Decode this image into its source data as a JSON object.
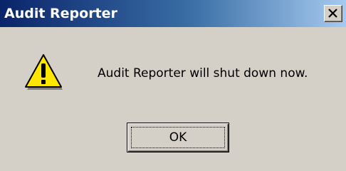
{
  "window": {
    "title": "Audit Reporter",
    "close_icon": "close-icon",
    "background_color": "#d4d0c8",
    "titlebar_colors": [
      "#0a246a",
      "#a6caf0"
    ]
  },
  "dialog": {
    "icon": "warning-icon",
    "message": "Audit Reporter will shut down now.",
    "ok_label": "OK"
  }
}
